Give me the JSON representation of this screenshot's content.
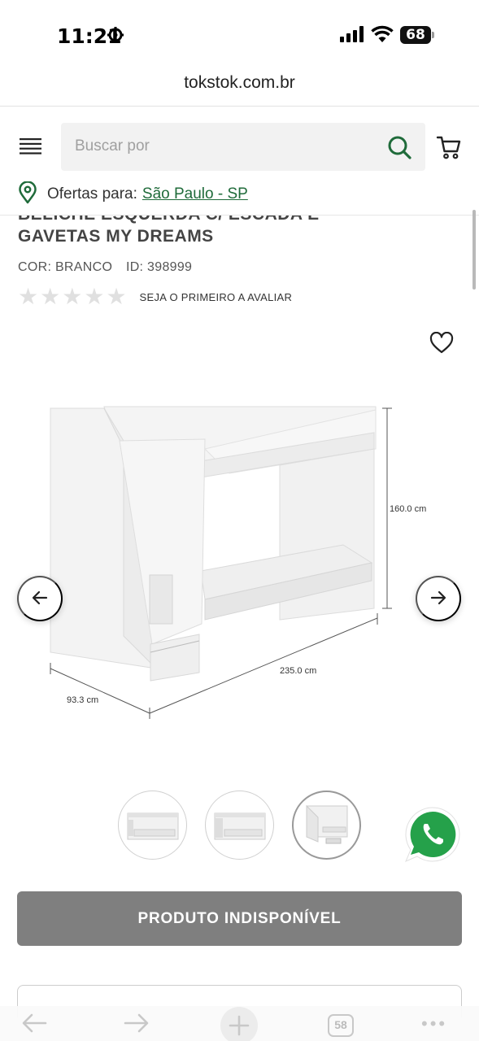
{
  "status_bar": {
    "time": "11:21",
    "battery": "68"
  },
  "browser": {
    "url": "tokstok.com.br",
    "tab_count": "58"
  },
  "header": {
    "search_placeholder": "Buscar por",
    "location_prefix": "Ofertas para:",
    "location_city": "São Paulo - SP",
    "brand_color": "#1f6b3a"
  },
  "product": {
    "title_line1_partial": "BELICHE ESQUERDA C/ ESCADA E",
    "title_line2": "GAVETAS MY DREAMS",
    "color_label": "COR: BRANCO",
    "id_label": "ID: 398999",
    "rating_stars": 0,
    "rating_max": 5,
    "rating_text": "SEJA O PRIMEIRO A AVALIAR",
    "dimensions": {
      "height": "160.0 cm",
      "width": "235.0 cm",
      "depth": "93.3 cm"
    },
    "thumbnails": 3,
    "active_thumbnail": 3,
    "cta_label": "PRODUTO INDISPONÍVEL",
    "cta_color": "#7f7f7f"
  },
  "icons": {
    "menu": "hamburger-icon",
    "search": "search-icon",
    "cart": "cart-icon",
    "location": "location-pin-icon",
    "favorite": "heart-icon",
    "prev": "arrow-left-icon",
    "next": "arrow-right-icon",
    "chat": "whatsapp-icon"
  }
}
